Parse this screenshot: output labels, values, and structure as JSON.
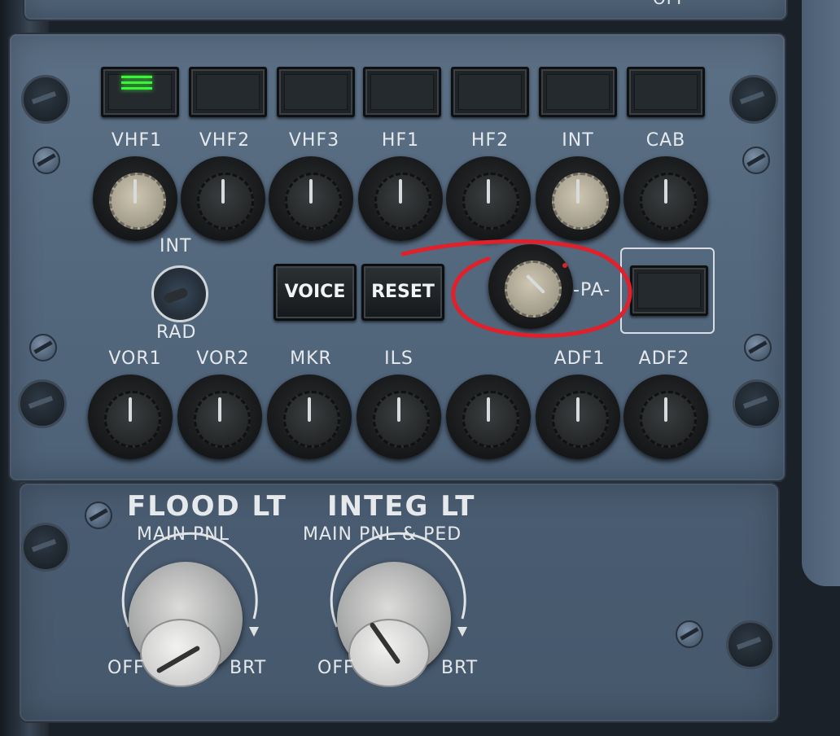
{
  "top_strip": {
    "text": "OFF"
  },
  "selectors": {
    "channels": [
      {
        "label": "VHF1",
        "active": true
      },
      {
        "label": "VHF2",
        "active": false
      },
      {
        "label": "VHF3",
        "active": false
      },
      {
        "label": "HF1",
        "active": false
      },
      {
        "label": "HF2",
        "active": false
      },
      {
        "label": "INT",
        "active": false
      },
      {
        "label": "CAB",
        "active": false
      }
    ]
  },
  "transmit_knobs": [
    "VHF1",
    "VHF2",
    "VHF3",
    "HF1",
    "HF2",
    "INT",
    "CAB"
  ],
  "int_rad": {
    "top": "INT",
    "bottom": "RAD"
  },
  "buttons": {
    "voice": "VOICE",
    "reset": "RESET"
  },
  "pa": {
    "label": "-PA-"
  },
  "nav_knobs": [
    "VOR1",
    "VOR2",
    "MKR",
    "ILS",
    "",
    "ADF1",
    "ADF2"
  ],
  "flood_lt": {
    "title": "FLOOD LT",
    "subtitle": "MAIN  PNL",
    "off": "OFF",
    "brt": "BRT"
  },
  "integ_lt": {
    "title": "INTEG LT",
    "subtitle": "MAIN  PNL  &  PED",
    "off": "OFF",
    "brt": "BRT"
  },
  "colors": {
    "lamp": "#3cf53a",
    "annotation": "#e0202a",
    "panel": "#56697f"
  }
}
